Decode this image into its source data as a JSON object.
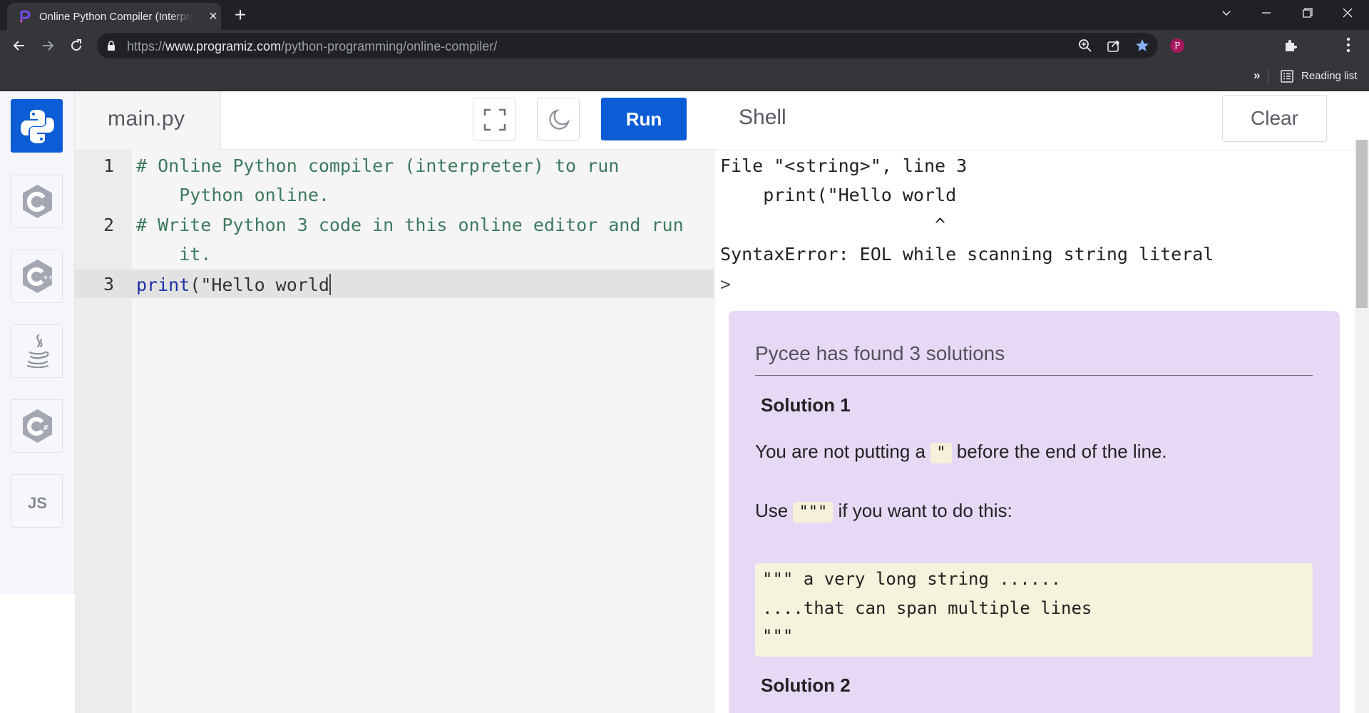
{
  "browser": {
    "tab_title": "Online Python Compiler (Interpreter)",
    "tab_close": "×",
    "new_tab": "+",
    "url_scheme": "https://",
    "url_host": "www.programiz.com",
    "url_path": "/python-programming/online-compiler/",
    "profile_initial": "P",
    "bookmarks_chevron": "»",
    "reading_list_label": "Reading list",
    "colors": {
      "tabbar": "#202124",
      "toolbar": "#35363a",
      "bookmark_star": "#8ab4f8"
    }
  },
  "sidebar": {
    "languages": [
      {
        "name": "python",
        "active": true
      },
      {
        "name": "c"
      },
      {
        "name": "cpp"
      },
      {
        "name": "java"
      },
      {
        "name": "csharp"
      },
      {
        "name": "javascript",
        "label": "JS"
      }
    ]
  },
  "editor": {
    "file_name": "main.py",
    "run_label": "Run",
    "lines": [
      {
        "num": "1",
        "text": "# Online Python compiler (interpreter) to run",
        "cont": "    Python online."
      },
      {
        "num": "2",
        "text": "# Write Python 3 code in this online editor and run",
        "cont": "    it."
      },
      {
        "num": "3",
        "keyword": "print",
        "rest": "(\"Hello world"
      }
    ],
    "colors": {
      "run_button": "#0b5cd5",
      "comment": "#3c7a5d",
      "keyword": "#1c2fa8"
    }
  },
  "shell": {
    "title": "Shell",
    "clear_label": "Clear",
    "output": [
      "File \"<string>\", line 3",
      "    print(\"Hello world",
      "                    ^",
      "SyntaxError: EOL while scanning string literal",
      ">"
    ],
    "pycee": {
      "title": "Pycee has found 3 solutions",
      "solution1_heading": "Solution 1",
      "solution1_text_before": "You are not putting a",
      "solution1_code": "\"",
      "solution1_text_after": "before the end of the line.",
      "use_before": "Use",
      "use_code": "\"\"\"",
      "use_after": "if you want to do this:",
      "code_block": [
        "\"\"\" a very long string ......",
        "....that can span multiple lines",
        "\"\"\""
      ],
      "solution2_heading": "Solution 2",
      "colors": {
        "panel": "#e6d9f5",
        "code_bg": "#f5f3dc"
      }
    }
  }
}
